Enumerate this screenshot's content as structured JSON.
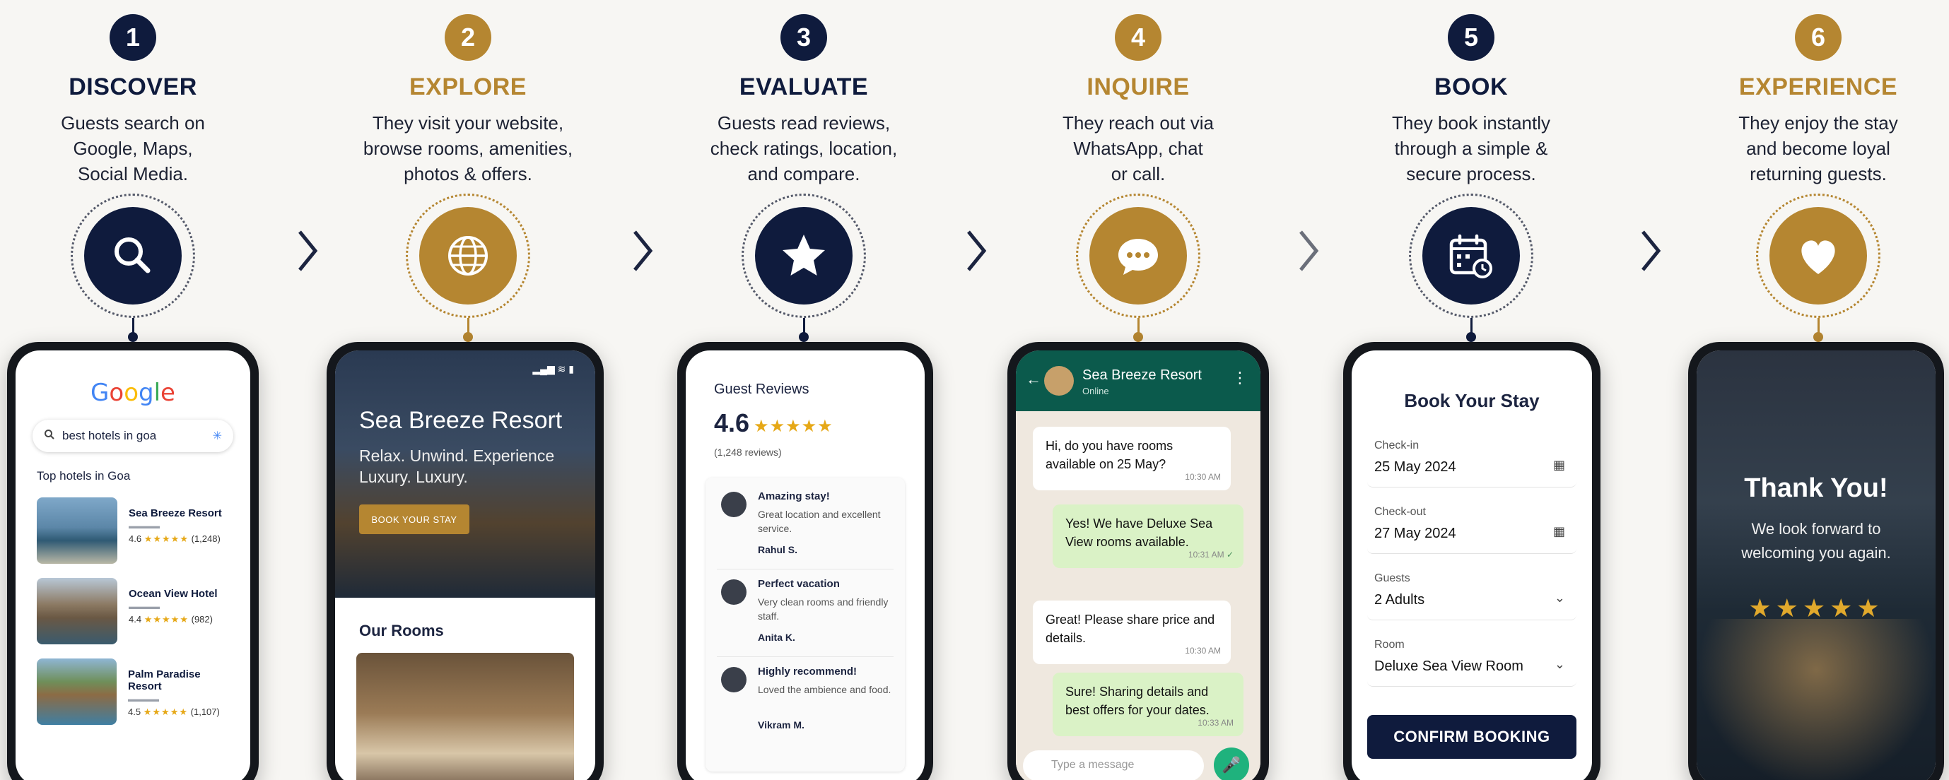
{
  "steps": [
    {
      "num": "1",
      "title": "DISCOVER",
      "desc": [
        "Guests search on",
        "Google, Maps,",
        "Social Media."
      ]
    },
    {
      "num": "2",
      "title": "EXPLORE",
      "desc": [
        "They visit your website,",
        "browse rooms, amenities,",
        "photos & offers."
      ]
    },
    {
      "num": "3",
      "title": "EVALUATE",
      "desc": [
        "Guests read reviews,",
        "check ratings, location,",
        "and compare."
      ]
    },
    {
      "num": "4",
      "title": "INQUIRE",
      "desc": [
        "They reach out via",
        "WhatsApp, chat",
        "or call."
      ]
    },
    {
      "num": "5",
      "title": "BOOK",
      "desc": [
        "They book instantly",
        "through a simple &",
        "secure process."
      ]
    },
    {
      "num": "6",
      "title": "EXPERIENCE",
      "desc": [
        "They enjoy the stay",
        "and become loyal",
        "returning guests."
      ]
    }
  ],
  "icons": [
    "search-icon",
    "globe-icon",
    "star-icon",
    "chat-icon",
    "calendar-icon",
    "heart-icon"
  ],
  "colors": {
    "navy": "#0f1b3d",
    "gold": "#b58631",
    "background": "#f7f6f3"
  },
  "google": {
    "logo": "Google",
    "query": "best hotels in goa",
    "section": "Top hotels in Goa",
    "hotels": [
      {
        "name": "Sea Breeze Resort",
        "rating": "4.6",
        "stars": "★★★★★",
        "count": "(1,248)"
      },
      {
        "name": "Ocean View Hotel",
        "rating": "4.4",
        "stars": "★★★★★",
        "count": "(982)"
      },
      {
        "name": "Palm Paradise Resort",
        "rating": "4.5",
        "stars": "★★★★★",
        "count": "(1,107)"
      }
    ]
  },
  "website": {
    "title": "Sea Breeze Resort",
    "tagline": "Relax. Unwind. Experience Luxury. Luxury.",
    "button": "BOOK YOUR STAY",
    "rooms_title": "Our Rooms"
  },
  "reviews": {
    "title": "Guest Reviews",
    "score": "4.6",
    "stars": "★★★★★",
    "count": "(1,248 reviews)",
    "items": [
      {
        "title": "Amazing stay!",
        "body": "Great location and excellent service.",
        "name": "Rahul S."
      },
      {
        "title": "Perfect vacation",
        "body": "Very clean rooms and friendly staff.",
        "name": "Anita K."
      },
      {
        "title": "Highly recommend!",
        "body": "Loved the ambience and food.",
        "name": "Vikram M."
      }
    ]
  },
  "chat": {
    "name": "Sea Breeze Resort",
    "status": "Online",
    "messages": [
      {
        "dir": "in",
        "text": "Hi, do you have rooms available on 25 May?",
        "time": "10:30 AM"
      },
      {
        "dir": "out",
        "text": "Yes! We have Deluxe Sea View rooms available.",
        "time": "10:31 AM"
      },
      {
        "dir": "in",
        "text": "Great! Please share price and details.",
        "time": "10:30 AM"
      },
      {
        "dir": "out",
        "text": "Sure! Sharing details and best offers for your dates.",
        "time": "10:33 AM"
      }
    ],
    "placeholder": "Type a message"
  },
  "booking": {
    "title": "Book Your Stay",
    "fields": [
      {
        "label": "Check-in",
        "value": "25 May 2024",
        "icon": "calendar-icon"
      },
      {
        "label": "Check-out",
        "value": "27 May 2024",
        "icon": "calendar-icon"
      },
      {
        "label": "Guests",
        "value": "2 Adults",
        "icon": "chevron-down-icon"
      },
      {
        "label": "Room",
        "value": "Deluxe Sea View Room",
        "icon": "chevron-down-icon"
      }
    ],
    "button": "CONFIRM BOOKING"
  },
  "thankyou": {
    "title": "Thank You!",
    "sub": [
      "We look forward to",
      "welcoming you again."
    ],
    "stars": "★★★★★"
  }
}
